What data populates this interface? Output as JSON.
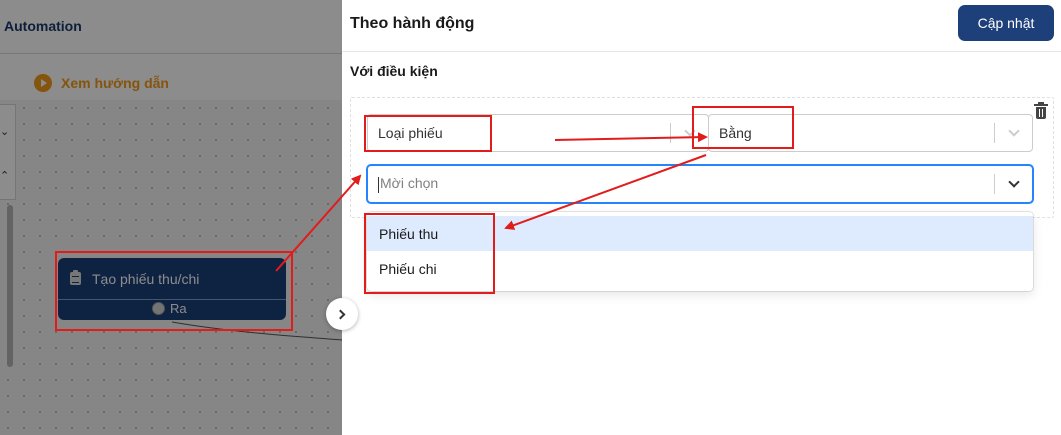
{
  "left": {
    "title": "Automation",
    "guide_label": "Xem hướng dẫn",
    "node": {
      "label": "Tạo phiếu thu/chi",
      "output_label": "Ra"
    }
  },
  "drawer": {
    "title": "Theo hành động",
    "update_label": "Cập nhật",
    "condition_label": "Với điều kiện",
    "condition": {
      "field_value": "Loại phiếu",
      "operator_value": "Bằng",
      "value_placeholder": "Mời chọn",
      "options": [
        {
          "label": "Phiếu thu"
        },
        {
          "label": "Phiếu chi"
        }
      ]
    }
  },
  "colors": {
    "primary": "#1d3f7a",
    "guide": "#f39a18",
    "annotation": "#e21b1b",
    "focus_border": "#2684ff",
    "option_highlight": "#deebff"
  },
  "icons": {
    "guide": "play-circle-icon",
    "node": "clipboard-icon",
    "delete": "trash-icon",
    "collapse": "chevron-right-icon",
    "dropdown": "chevron-down-icon"
  }
}
